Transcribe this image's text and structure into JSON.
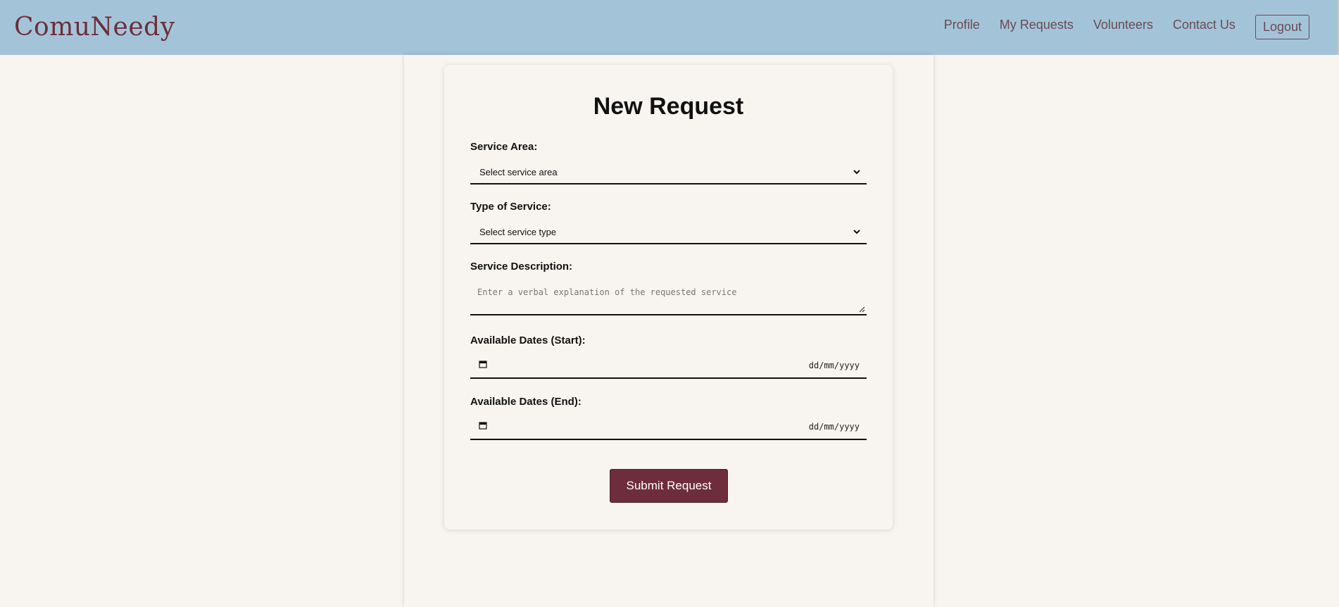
{
  "brand": "ComuNeedy",
  "nav": {
    "links": [
      "Profile",
      "My Requests",
      "Volunteers",
      "Contact Us"
    ],
    "logout": "Logout"
  },
  "form": {
    "title": "New Request",
    "service_area": {
      "label": "Service Area:",
      "value": "Select service area"
    },
    "service_type": {
      "label": "Type of Service:",
      "value": "Select service type"
    },
    "description": {
      "label": "Service Description:",
      "placeholder": "Enter a verbal explanation of the requested service"
    },
    "start_date": {
      "label": "Available Dates (Start):",
      "placeholder": "dd/mm/yyyy"
    },
    "end_date": {
      "label": "Available Dates (End):",
      "placeholder": "dd/mm/yyyy"
    },
    "submit": "Submit Request"
  },
  "icons": {
    "dropdown": "chevron-down-icon",
    "date": "calendar-icon",
    "resize": "resize-handle-icon"
  },
  "colors": {
    "navbar": "#a3c4d8",
    "brand": "#6e2d3a",
    "background": "#f8f5f0",
    "primary_button": "#6e2d3a"
  }
}
